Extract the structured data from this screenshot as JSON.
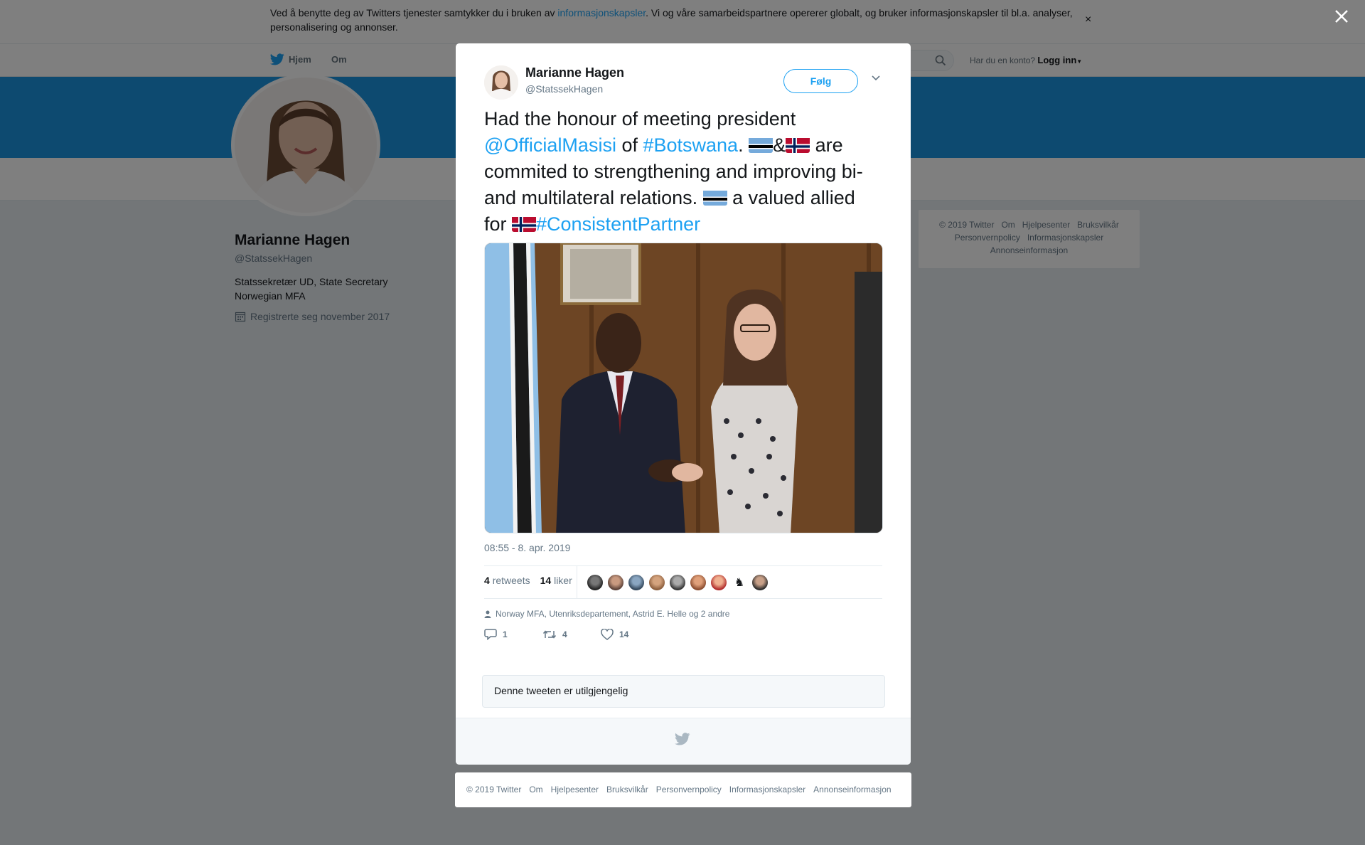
{
  "cookie": {
    "text_before": "Ved å benytte deg av Twitters tjenester samtykker du i bruken av ",
    "link": "informasjonskapsler",
    "text_after": ". Vi og våre samarbeidspartnere opererer globalt, og bruker informasjonskapsler til bl.a. analyser, personalisering og annonser.",
    "close": "×"
  },
  "nav": {
    "home": "Hjem",
    "about": "Om",
    "have_account": "Har du en konto?",
    "login": "Logg inn"
  },
  "profile": {
    "name": "Marianne Hagen",
    "handle": "@StatssekHagen",
    "bio_line1": "Statssekretær UD, State Secretary",
    "bio_line2": "Norwegian MFA",
    "joined": "Registrerte seg november 2017"
  },
  "side_footer": {
    "items": [
      "© 2019 Twitter",
      "Om",
      "Hjelpesenter",
      "Bruksvilkår",
      "Personvernpolicy",
      "Informasjonskapsler",
      "Annonseinformasjon"
    ]
  },
  "tweet": {
    "author_name": "Marianne Hagen",
    "author_handle": "@StatssekHagen",
    "follow_label": "Følg",
    "text_1": "Had the honour of meeting president ",
    "mention": "@OfficialMasisi",
    "text_2": " of ",
    "hashtag1": "#Botswana",
    "text_3": ". ",
    "ampersand": "&",
    "text_4": " are commited to strengthening and improving bi- and multilateral relations. ",
    "text_5": " a valued allied for ",
    "hashtag2": "#ConsistentPartner",
    "timestamp": "08:55 - 8. apr. 2019",
    "retweets_count": "4",
    "retweets_label": "retweets",
    "likes_count": "14",
    "likes_label": "liker",
    "liked_by": "Norway MFA, Utenriksdepartement, Astrid E. Helle og 2 andre",
    "reply_count": "1",
    "retweet_count": "4",
    "like_count": "14",
    "unavailable": "Denne tweeten er utilgjengelig"
  },
  "bottom_footer": {
    "items": [
      "© 2019 Twitter",
      "Om",
      "Hjelpesenter",
      "Bruksvilkår",
      "Personvernpolicy",
      "Informasjonskapsler",
      "Annonseinformasjon"
    ]
  },
  "colors": {
    "twitter_blue": "#1da1f2",
    "banner_blue": "#1b95e0",
    "botswana_blue": "#75aadb",
    "norway_red": "#ba0c2f",
    "norway_blue": "#00205b"
  }
}
